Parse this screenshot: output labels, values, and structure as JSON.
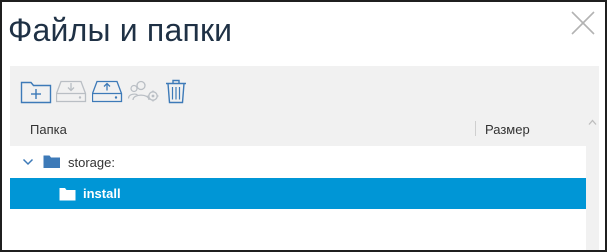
{
  "dialog": {
    "title": "Файлы и папки"
  },
  "toolbar": {
    "buttons": [
      {
        "icon": "new-folder-icon",
        "enabled": true
      },
      {
        "icon": "download-drive-icon",
        "enabled": false
      },
      {
        "icon": "upload-drive-icon",
        "enabled": true
      },
      {
        "icon": "user-permissions-icon",
        "enabled": false
      },
      {
        "icon": "trash-icon",
        "enabled": true
      }
    ]
  },
  "table": {
    "columns": [
      "Папка",
      "Размер"
    ],
    "rows": [
      {
        "name": "storage:",
        "level": 0,
        "expanded": true,
        "selected": false
      },
      {
        "name": "install",
        "level": 1,
        "selected": true
      }
    ]
  },
  "colors": {
    "accent": "#0096d6",
    "icon_blue": "#3d7ab8",
    "title_text": "#1f3145",
    "disabled_icon": "#b9bec4"
  }
}
